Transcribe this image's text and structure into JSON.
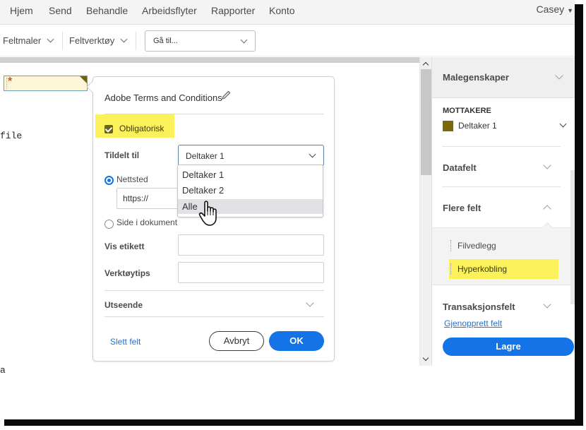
{
  "nav": {
    "items": [
      "Hjem",
      "Send",
      "Behandle",
      "Arbeidsflyter",
      "Rapporter",
      "Konto"
    ],
    "user": "Casey"
  },
  "toolbar": {
    "field_templates": "Feltmaler",
    "field_tools": "Feltverktøy",
    "goto_placeholder": "Gå til..."
  },
  "document": {
    "required_marker": "*",
    "text_fragment": "file",
    "text_fragment2": "a"
  },
  "popup": {
    "title": "Adobe Terms and Conditions",
    "required_label": "Obligatorisk",
    "required_checked": true,
    "assigned_label": "Tildelt til",
    "assigned_value": "Deltaker 1",
    "dropdown_options": [
      "Deltaker 1",
      "Deltaker 2",
      "Alle"
    ],
    "dropdown_hovered": "Alle",
    "radio_website": "Nettsted",
    "radio_website_selected": true,
    "url_value": "https://",
    "radio_page": "Side i dokument",
    "display_label": "Vis etikett",
    "display_value": "",
    "tooltip_label": "Verktøytips",
    "tooltip_value": "",
    "appearance": "Utseende",
    "delete_field": "Slett felt",
    "cancel": "Avbryt",
    "ok": "OK"
  },
  "panel": {
    "template_props": "Malegenskaper",
    "recipients_caption": "MOTTAKERE",
    "recipient": "Deltaker 1",
    "recipient_color": "#7a6a06",
    "data_fields": "Datafelt",
    "more_fields": "Flere felt",
    "more_fields_items": [
      "Filvedlegg",
      "Hyperkobling"
    ],
    "more_fields_highlighted": "Hyperkobling",
    "transaction_fields": "Transaksjonsfelt",
    "restore_fields": "Gjenopprett felt",
    "save": "Lagre"
  },
  "colors": {
    "accent": "#1473e6",
    "highlight": "#fbf15a",
    "required_star": "#e0501f"
  }
}
